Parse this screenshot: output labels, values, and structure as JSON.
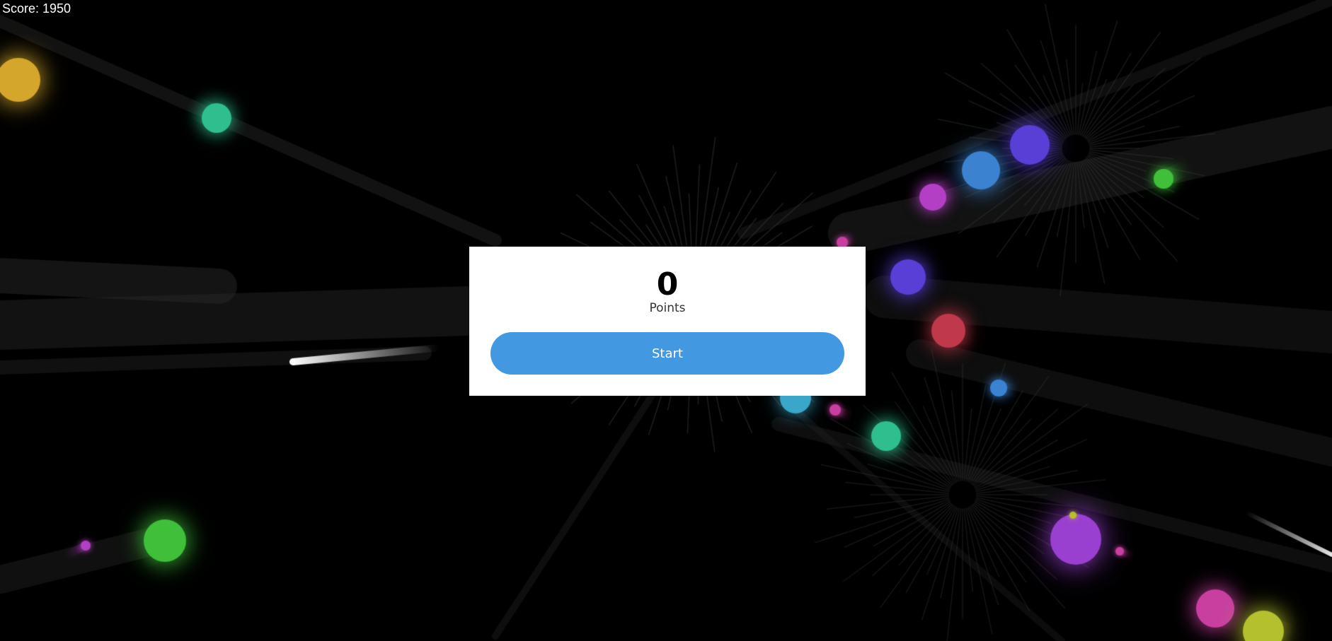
{
  "hud": {
    "score_text": "Score: 1950"
  },
  "menu": {
    "points_value": "0",
    "points_label": "Points",
    "start_label": "Start"
  },
  "colors": {
    "background": "#000000",
    "panel": "#ffffff",
    "button": "#4299e1",
    "button_text": "#ffffff",
    "streak": "#1a1a1a"
  },
  "scene": {
    "orb_colors": [
      "#d4a72c",
      "#2fbf8f",
      "#5a3fd6",
      "#3b82d0",
      "#b33fc4",
      "#3fbf3a",
      "#c0394a",
      "#3aa6c8",
      "#c83fa0",
      "#9a40d0",
      "#b5c02e",
      "#e8e8e8"
    ]
  }
}
